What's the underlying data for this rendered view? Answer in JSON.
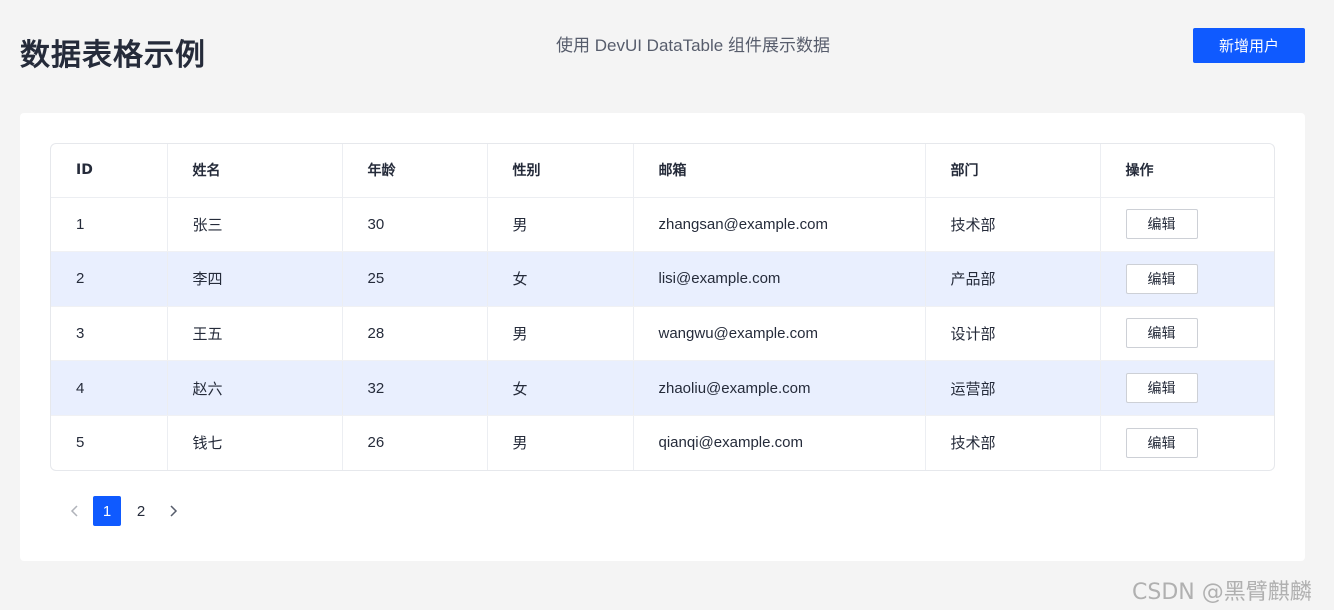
{
  "header": {
    "title": "数据表格示例",
    "subtitle": "使用 DevUI DataTable 组件展示数据",
    "add_user_label": "新增用户"
  },
  "table": {
    "columns": [
      "ID",
      "姓名",
      "年龄",
      "性别",
      "邮箱",
      "部门",
      "操作"
    ],
    "rows": [
      {
        "id": "1",
        "name": "张三",
        "age": "30",
        "gender": "男",
        "email": "zhangsan@example.com",
        "dept": "技术部",
        "action": "编辑"
      },
      {
        "id": "2",
        "name": "李四",
        "age": "25",
        "gender": "女",
        "email": "lisi@example.com",
        "dept": "产品部",
        "action": "编辑"
      },
      {
        "id": "3",
        "name": "王五",
        "age": "28",
        "gender": "男",
        "email": "wangwu@example.com",
        "dept": "设计部",
        "action": "编辑"
      },
      {
        "id": "4",
        "name": "赵六",
        "age": "32",
        "gender": "女",
        "email": "zhaoliu@example.com",
        "dept": "运营部",
        "action": "编辑"
      },
      {
        "id": "5",
        "name": "钱七",
        "age": "26",
        "gender": "男",
        "email": "qianqi@example.com",
        "dept": "技术部",
        "action": "编辑"
      }
    ]
  },
  "pagination": {
    "prev_icon": "chevron-left-icon",
    "next_icon": "chevron-right-icon",
    "pages": [
      "1",
      "2"
    ],
    "current": "1"
  },
  "watermark": "CSDN @黑臂麒麟",
  "colors": {
    "accent": "#0f5aff",
    "stripe": "#e9effe",
    "background": "#f4f4f4"
  }
}
